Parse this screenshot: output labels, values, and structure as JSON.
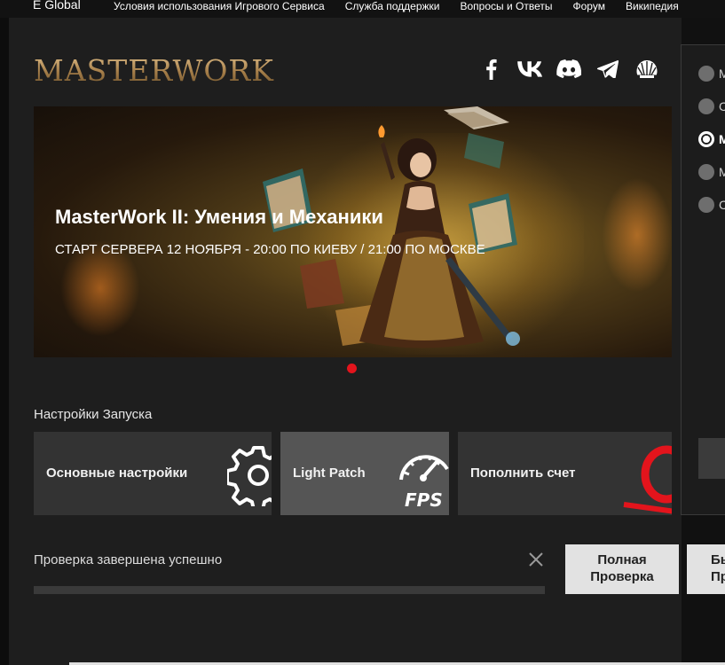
{
  "topnav": {
    "brand": "E Global",
    "links": [
      "Условия использования Игрового Сервиса",
      "Служба поддержки",
      "Вопросы и Ответы",
      "Форум",
      "Википедия"
    ]
  },
  "header": {
    "logo": "MASTERWORK",
    "socials": [
      "facebook-icon",
      "vk-icon",
      "discord-icon",
      "telegram-icon",
      "shell-icon"
    ]
  },
  "banner": {
    "title": "MasterWork II: Умения и Механики",
    "subtitle": "СТАРТ СЕРВЕРА 12 НОЯБРЯ - 20:00 ПО КИЕВУ / 21:00 ПО МОСКВЕ",
    "active_slide": 1,
    "slide_count": 1
  },
  "launch": {
    "section_title": "Настройки Запуска",
    "tiles": [
      {
        "label": "Основные настройки",
        "icon": "gear-icon"
      },
      {
        "label": "Light Patch",
        "icon": "fps-gauge-icon"
      },
      {
        "label": "Пополнить счет",
        "icon": "coin-icon"
      }
    ]
  },
  "status": {
    "text": "Проверка завершена успешно",
    "progress": 1.0
  },
  "buttons": {
    "full_check": "Полная\nПроверка",
    "fast_check_1": "Бы",
    "fast_check_2": "Пр"
  },
  "server_list": {
    "items": [
      {
        "label": "M",
        "selected": false
      },
      {
        "label": "C",
        "selected": false
      },
      {
        "label": "M",
        "selected": true
      },
      {
        "label": "M",
        "selected": false
      },
      {
        "label": "C",
        "selected": false
      }
    ]
  },
  "colors": {
    "accent": "#e3141c",
    "logo_gold": "#b89461",
    "panel": "#1e1e1e",
    "tile": "#333333",
    "tile_active": "#555555"
  }
}
